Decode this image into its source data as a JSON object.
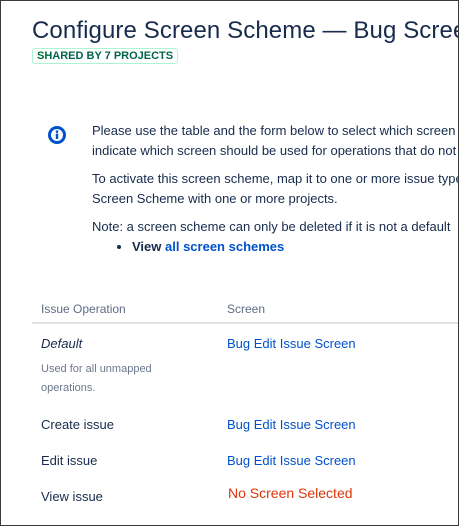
{
  "header": {
    "title": "Configure Screen Scheme — Bug Screen Scheme",
    "shared_badge": "SHARED BY 7 PROJECTS"
  },
  "info": {
    "icon": "info-icon",
    "paragraph1": "Please use the table and the form below to select which screen should be displayed for each issue operation. Then indicate which screen should be used for operations that do not have an explicitly mapped screen.",
    "paragraph1_line1": "Please use the table and the form below to select which screen",
    "paragraph1_line2": "indicate which screen should be used for operations that do not",
    "paragraph2_line1": "To activate this screen scheme, map it to one or more issue types",
    "paragraph2_line2": "Screen Scheme with one or more projects.",
    "paragraph3": "Note: a screen scheme can only be deleted if it is not a default",
    "view_prefix": "View",
    "view_link": "all screen schemes"
  },
  "table": {
    "headers": {
      "operation": "Issue Operation",
      "screen": "Screen"
    },
    "rows": [
      {
        "operation": "Default",
        "description": "Used for all unmapped operations.",
        "screen": "Bug Edit Issue Screen"
      },
      {
        "operation": "Create issue",
        "screen": "Bug Edit Issue Screen"
      },
      {
        "operation": "Edit issue",
        "screen": "Bug Edit Issue Screen"
      },
      {
        "operation": "View issue",
        "screen": "No Screen Selected"
      }
    ]
  },
  "colors": {
    "link": "#0052cc",
    "error": "#de350b",
    "badge_text": "#006644",
    "info_icon": "#0052cc"
  }
}
